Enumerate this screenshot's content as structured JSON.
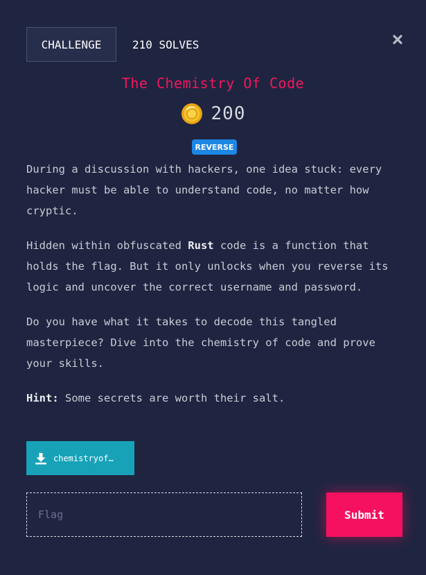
{
  "header": {
    "challenge_tab": "CHALLENGE",
    "solves_tab": "210 SOLVES"
  },
  "challenge": {
    "title": "The Chemistry Of Code",
    "points": "200",
    "category": "REVERSE",
    "description": {
      "p1": "During a discussion with hackers, one idea stuck: every hacker must be able to understand code, no matter how cryptic.",
      "p2_before": "Hidden within obfuscated ",
      "p2_bold": "Rust",
      "p2_after": " code is a function that holds the flag. But it only unlocks when you reverse its logic and uncover the correct username and password.",
      "p3": "Do you have what it takes to decode this tangled masterpiece? Dive into the chemistry of code and prove your skills.",
      "hint_label": "Hint:",
      "hint_text": " Some secrets are worth their salt."
    },
    "file": {
      "label": "chemistryof…",
      "icon": "download-icon"
    }
  },
  "form": {
    "flag_placeholder": "Flag",
    "flag_value": "",
    "submit_label": "Submit"
  },
  "colors": {
    "background": "#1f2540",
    "title": "#f4165f",
    "badge": "#1d87e5",
    "file_button": "#17a2b8",
    "submit_button": "#f5115f"
  },
  "icons": {
    "close": "close-icon",
    "coin": "coin-icon"
  }
}
